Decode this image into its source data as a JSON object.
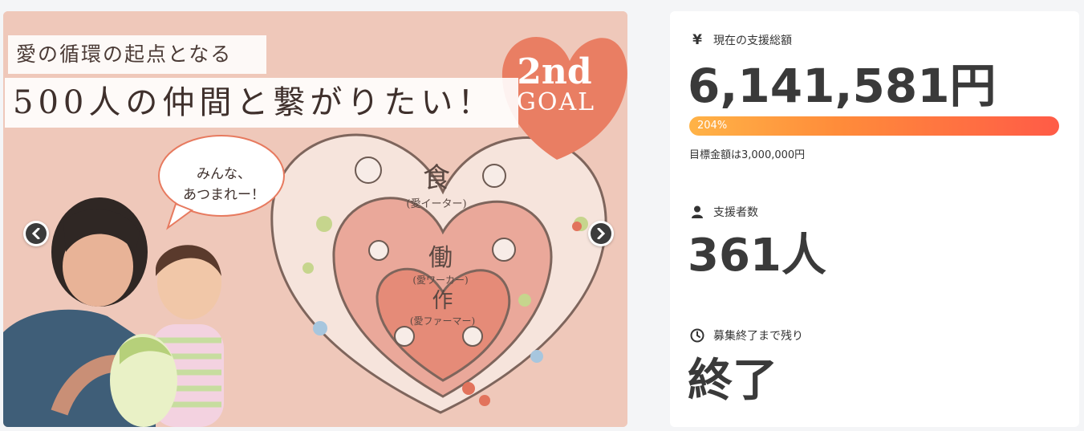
{
  "hero": {
    "tagline_small": "愛の循環の起点となる",
    "tagline_large": "500人の仲間と繋がりたい！",
    "goal_number": "2nd",
    "goal_word": "GOAL",
    "speech_bubble": "みんな、\nあつまれー！",
    "circle_outer_title": "食",
    "circle_outer_sub": "(愛イーター)",
    "circle_middle_title": "働",
    "circle_middle_sub": "(愛ワーカー)",
    "circle_inner_title": "作",
    "circle_inner_sub": "(愛ファーマー)",
    "prev_icon": "chevron-left-icon",
    "next_icon": "chevron-right-icon"
  },
  "stats": {
    "funding_label": "現在の支援総額",
    "funding_amount": "6,141,581円",
    "progress_percent": "204%",
    "progress_fraction": 1.0,
    "target_text": "目標金額は3,000,000円",
    "supporters_label": "支援者数",
    "supporters_value": "361人",
    "remaining_label": "募集終了まで残り",
    "remaining_value": "終了"
  },
  "colors": {
    "hero_bg": "#efc8ba",
    "heart_coral": "#ea7f63",
    "progress_start": "#ffb347",
    "progress_end": "#ff5b47"
  }
}
